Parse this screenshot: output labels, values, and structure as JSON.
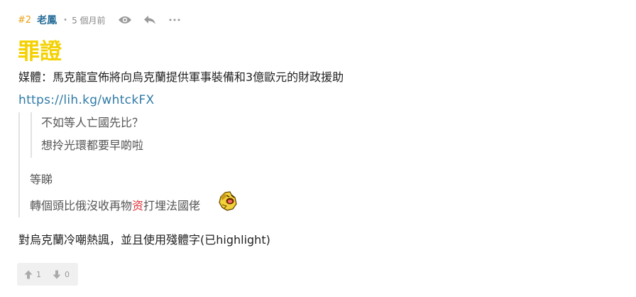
{
  "post": {
    "number": "#2",
    "author": "老鳳",
    "separator": "•",
    "time": "5 個月前",
    "icons": [
      "eye-icon",
      "reply-icon",
      "more-icon"
    ],
    "title": "罪證",
    "headline": "媒體：馬克龍宣佈將向烏克蘭提供軍事裝備和3億歐元的財政援助",
    "link": "https://lih.kg/whtckFX",
    "quote": {
      "inner_lines": [
        "不如等人亡國先比？",
        "想拎光環都要早啲啦"
      ],
      "reply_line1": "等睇",
      "reply_line2_before": "轉個頭比俄沒收再物",
      "reply_line2_highlight": "资",
      "reply_line2_after": "打埋法國佬",
      "emoji": "bald-face-emoji"
    },
    "comment": "對烏克蘭冷嘲熱諷，並且使用殘體字(已highlight)"
  },
  "votes": {
    "up": "1",
    "down": "0"
  },
  "colors": {
    "post_number": "#e8a317",
    "author": "#2b6f9a",
    "title": "#f4d100",
    "link": "#2f7aa6",
    "highlight": "#e0343a"
  }
}
